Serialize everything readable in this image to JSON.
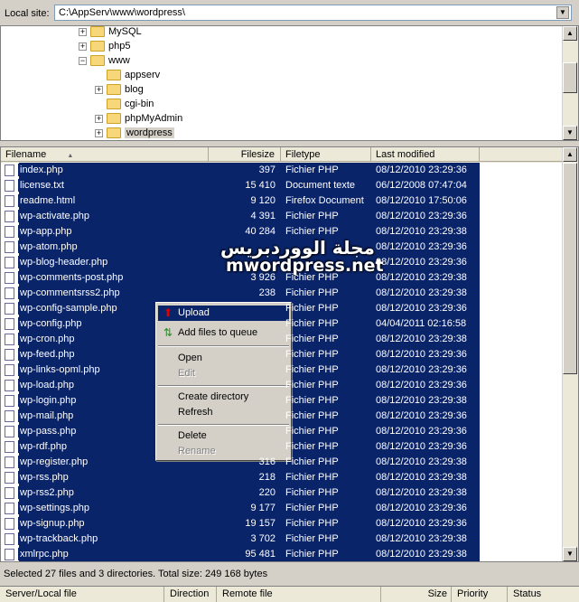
{
  "local_site": {
    "label": "Local site:",
    "path": "C:\\AppServ\\www\\wordpress\\"
  },
  "tree": [
    {
      "name": "MySQL",
      "expander": "+",
      "level": 1
    },
    {
      "name": "php5",
      "expander": "+",
      "level": 1
    },
    {
      "name": "www",
      "expander": "−",
      "level": 1
    },
    {
      "name": "appserv",
      "expander": "",
      "level": 2
    },
    {
      "name": "blog",
      "expander": "+",
      "level": 2
    },
    {
      "name": "cgi-bin",
      "expander": "",
      "level": 2
    },
    {
      "name": "phpMyAdmin",
      "expander": "+",
      "level": 2
    },
    {
      "name": "wordpress",
      "expander": "+",
      "level": 2,
      "selected": true
    }
  ],
  "columns": {
    "filename": "Filename",
    "filesize": "Filesize",
    "filetype": "Filetype",
    "modified": "Last modified"
  },
  "files": [
    {
      "name": "index.php",
      "size": "397",
      "type": "Fichier PHP",
      "date": "08/12/2010 23:29:36"
    },
    {
      "name": "license.txt",
      "size": "15 410",
      "type": "Document texte",
      "date": "06/12/2008 07:47:04"
    },
    {
      "name": "readme.html",
      "size": "9 120",
      "type": "Firefox Document",
      "date": "08/12/2010 17:50:06"
    },
    {
      "name": "wp-activate.php",
      "size": "4 391",
      "type": "Fichier PHP",
      "date": "08/12/2010 23:29:36"
    },
    {
      "name": "wp-app.php",
      "size": "40 284",
      "type": "Fichier PHP",
      "date": "08/12/2010 23:29:38"
    },
    {
      "name": "wp-atom.php",
      "size": "",
      "type": "",
      "date": "08/12/2010 23:29:36"
    },
    {
      "name": "wp-blog-header.php",
      "size": "",
      "type": "",
      "date": "08/12/2010 23:29:36"
    },
    {
      "name": "wp-comments-post.php",
      "size": "3 926",
      "type": "Fichier PHP",
      "date": "08/12/2010 23:29:38"
    },
    {
      "name": "wp-commentsrss2.php",
      "size": "238",
      "type": "Fichier PHP",
      "date": "08/12/2010 23:29:38"
    },
    {
      "name": "wp-config-sample.php",
      "size": "",
      "type": "Fichier PHP",
      "date": "08/12/2010 23:29:36"
    },
    {
      "name": "wp-config.php",
      "size": "",
      "type": "Fichier PHP",
      "date": "04/04/2011 02:16:58"
    },
    {
      "name": "wp-cron.php",
      "size": "",
      "type": "Fichier PHP",
      "date": "08/12/2010 23:29:38"
    },
    {
      "name": "wp-feed.php",
      "size": "",
      "type": "Fichier PHP",
      "date": "08/12/2010 23:29:36"
    },
    {
      "name": "wp-links-opml.php",
      "size": "",
      "type": "Fichier PHP",
      "date": "08/12/2010 23:29:36"
    },
    {
      "name": "wp-load.php",
      "size": "",
      "type": "Fichier PHP",
      "date": "08/12/2010 23:29:36"
    },
    {
      "name": "wp-login.php",
      "size": "",
      "type": "Fichier PHP",
      "date": "08/12/2010 23:29:38"
    },
    {
      "name": "wp-mail.php",
      "size": "",
      "type": "Fichier PHP",
      "date": "08/12/2010 23:29:36"
    },
    {
      "name": "wp-pass.php",
      "size": "",
      "type": "Fichier PHP",
      "date": "08/12/2010 23:29:36"
    },
    {
      "name": "wp-rdf.php",
      "size": "",
      "type": "Fichier PHP",
      "date": "08/12/2010 23:29:36"
    },
    {
      "name": "wp-register.php",
      "size": "316",
      "type": "Fichier PHP",
      "date": "08/12/2010 23:29:38"
    },
    {
      "name": "wp-rss.php",
      "size": "218",
      "type": "Fichier PHP",
      "date": "08/12/2010 23:29:38"
    },
    {
      "name": "wp-rss2.php",
      "size": "220",
      "type": "Fichier PHP",
      "date": "08/12/2010 23:29:38"
    },
    {
      "name": "wp-settings.php",
      "size": "9 177",
      "type": "Fichier PHP",
      "date": "08/12/2010 23:29:36"
    },
    {
      "name": "wp-signup.php",
      "size": "19 157",
      "type": "Fichier PHP",
      "date": "08/12/2010 23:29:36"
    },
    {
      "name": "wp-trackback.php",
      "size": "3 702",
      "type": "Fichier PHP",
      "date": "08/12/2010 23:29:38"
    },
    {
      "name": "xmlrpc.php",
      "size": "95 481",
      "type": "Fichier PHP",
      "date": "08/12/2010 23:29:38"
    }
  ],
  "context_menu": {
    "upload": "Upload",
    "add_to_queue": "Add files to queue",
    "open": "Open",
    "edit": "Edit",
    "create_directory": "Create directory",
    "refresh": "Refresh",
    "delete": "Delete",
    "rename": "Rename"
  },
  "watermark": {
    "arabic": "مجلة الووردبريس",
    "latin": "mwordpress.net"
  },
  "status": "Selected 27 files and 3 directories. Total size: 249 168 bytes",
  "queue_columns": {
    "server": "Server/Local file",
    "direction": "Direction",
    "remote": "Remote file",
    "size": "Size",
    "priority": "Priority",
    "status": "Status"
  },
  "colors": {
    "selection": "#0a246a",
    "chrome": "#d4d0c8",
    "folder": "#f8d77a"
  }
}
